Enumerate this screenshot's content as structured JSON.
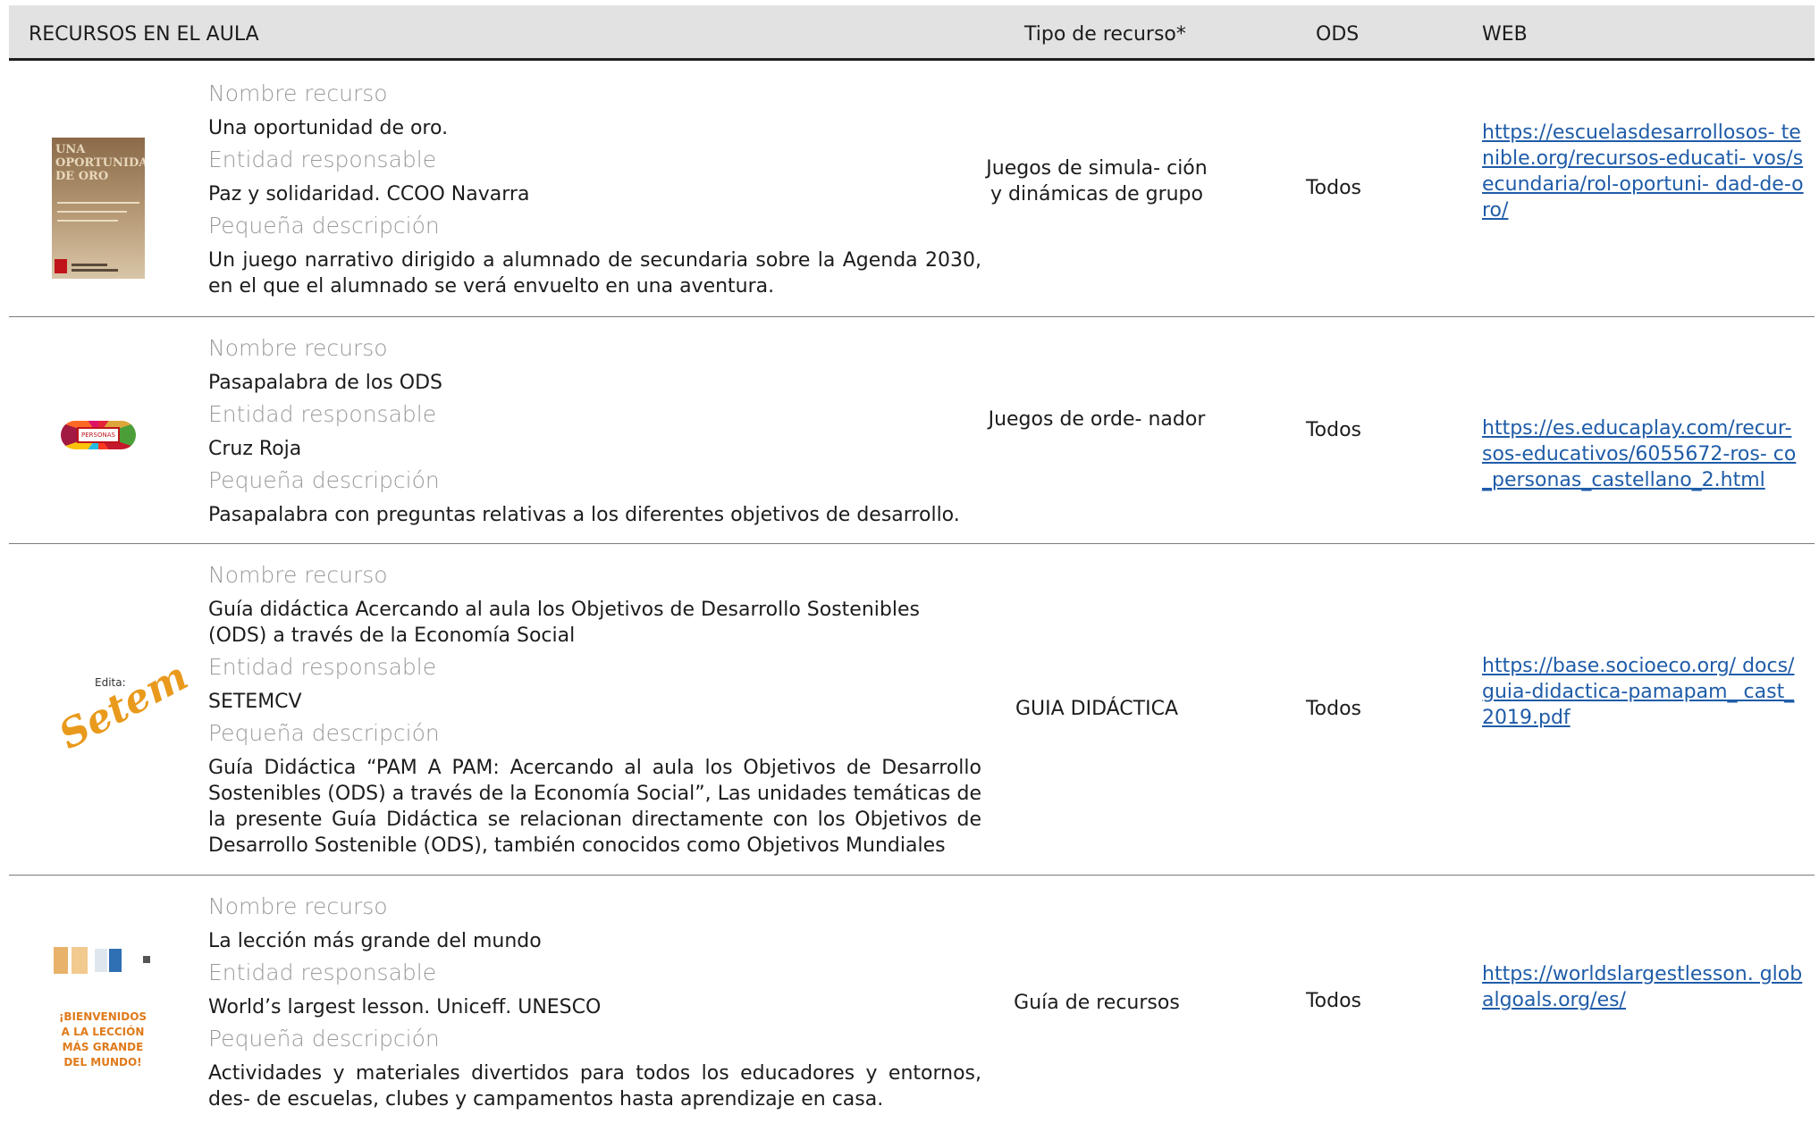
{
  "header": {
    "col_resources": "RECURSOS EN EL AULA",
    "col_type": "Tipo de recurso*",
    "col_ods": "ODS",
    "col_web": "WEB"
  },
  "labels": {
    "name": "Nombre recurso",
    "entity": "Entidad responsable",
    "description": "Pequeña descripción"
  },
  "rows": [
    {
      "name": "Una oportunidad de oro.",
      "entity": "Paz y solidaridad. CCOO Navarra",
      "description": "Un juego narrativo dirigido a alumnado de secundaria sobre la Agenda 2030, en el que el alumnado se verá envuelto en una aventura.",
      "type": "Juegos de simula- ción y dinámicas de grupo",
      "ods": "Todos",
      "web": "https://escuelasdesarrollosos- tenible.org/recursos-educati- vos/secundaria/rol-oportuni- dad-de-oro/",
      "thumb_text": "UNA OPORTUNIDAD DE ORO"
    },
    {
      "name": "Pasapalabra de los ODS",
      "entity": "Cruz Roja",
      "description": "Pasapalabra con preguntas relativas a los diferentes objetivos de desarrollo.",
      "type": "Juegos de orde- nador",
      "ods": "Todos",
      "web": "https://es.educaplay.com/recur- sos-educativos/6055672-ros- co_personas_castellano_2.html",
      "thumb_text": "PERSONAS 1"
    },
    {
      "name": "Guía didáctica Acercando al aula los Objetivos de Desarrollo Sostenibles (ODS) a través de la Economía Social",
      "entity": "SETEMCV",
      "description": "Guía Didáctica “PAM A PAM: Acercando al aula los Objetivos de Desarrollo Sostenibles (ODS) a través de la Economía Social”, Las unidades temáticas de la presente Guía Didáctica se relacionan directamente con los Objetivos de Desarrollo Sostenible (ODS), también conocidos como Objetivos Mundiales",
      "type": "GUIA DIDÁCTICA",
      "ods": "Todos",
      "web": "https://base.socioeco.org/ docs/guia-didactica-pamapam_ cast_2019.pdf",
      "thumb_caption": "Edita:",
      "thumb_logo": "Setem"
    },
    {
      "name": "La lección más grande del mundo",
      "entity": "World’s largest lesson. Uniceff. UNESCO",
      "description": "Actividades y materiales divertidos para todos los educadores y entornos, des- de escuelas, clubes y campamentos hasta aprendizaje en casa.",
      "type": "Guía de recursos",
      "ods": "Todos",
      "web": "https://worldslargestlesson. globalgoals.org/es/",
      "thumb_text": "¡BIENVENIDOS A LA LECCIÓN MÁS GRANDE DEL MUNDO!"
    }
  ],
  "colors": {
    "header_bg": "#e2e2e2",
    "link": "#1f5ca8",
    "label_grey": "#9a9a9a",
    "setem_orange": "#e99a1c"
  }
}
